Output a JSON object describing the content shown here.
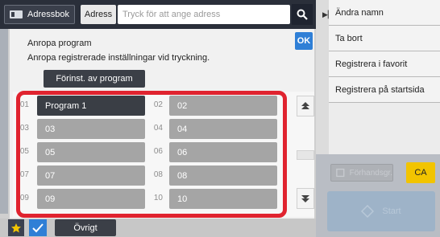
{
  "topbar": {
    "addressbook_label": "Adressbok",
    "address_tab_label": "Adress",
    "address_placeholder": "Tryck för att ange adress"
  },
  "right_menu": {
    "items": [
      "Ändra namn",
      "Ta bort",
      "Registrera i favorit",
      "Registrera på startsida"
    ],
    "ghost_button_label": "Förhandsgr.",
    "ca_label": "CA",
    "start_label": "Start"
  },
  "dialog": {
    "title": "Anropa program",
    "description": "Anropa registrerade inställningar vid tryckning.",
    "ok_label": "OK",
    "preset_button_label": "Förinst. av program"
  },
  "program_slots": [
    {
      "num": "01",
      "label": "Program 1",
      "selected": true
    },
    {
      "num": "02",
      "label": "02",
      "selected": false
    },
    {
      "num": "03",
      "label": "03",
      "selected": false
    },
    {
      "num": "04",
      "label": "04",
      "selected": false
    },
    {
      "num": "05",
      "label": "05",
      "selected": false
    },
    {
      "num": "06",
      "label": "06",
      "selected": false
    },
    {
      "num": "07",
      "label": "07",
      "selected": false
    },
    {
      "num": "08",
      "label": "08",
      "selected": false
    },
    {
      "num": "09",
      "label": "09",
      "selected": false
    },
    {
      "num": "10",
      "label": "10",
      "selected": false
    }
  ],
  "bottombar": {
    "other_label": "Övrigt"
  },
  "colors": {
    "highlight": "#e0232f",
    "ok_blue": "#2f7fd6",
    "ca_yellow": "#f2c400"
  }
}
